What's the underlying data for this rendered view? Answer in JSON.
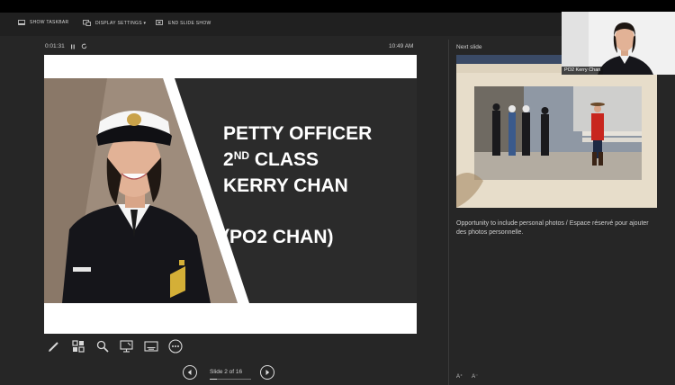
{
  "toolbar": {
    "show_taskbar": "SHOW TASKBAR",
    "display_settings": "DISPLAY SETTINGS ▾",
    "end_slideshow": "END SLIDE SHOW"
  },
  "presenter": {
    "timer": "0:01:31",
    "clock": "10:49 AM"
  },
  "current_slide": {
    "title_line1": "PETTY OFFICER",
    "title_line2_num": "2",
    "title_line2_sup": "ND",
    "title_line2_rest": " CLASS",
    "title_line3": "KERRY CHAN",
    "short_name": "(PO2 CHAN)"
  },
  "navigation": {
    "slide_counter": "Slide 2 of 16"
  },
  "next_slide": {
    "label": "Next slide"
  },
  "notes": {
    "text": "Opportunity to include personal photos / Espace réservé pour ajouter des photos personnelle."
  },
  "font_controls": {
    "increase": "A⁺",
    "decrease": "A⁻"
  },
  "video": {
    "participant_name": "PO2 Kerry Chan"
  },
  "colors": {
    "background": "#262626",
    "slide_band": "#2b2b2b",
    "uniform": "#15151a",
    "rcmp_red": "#c8261e"
  }
}
